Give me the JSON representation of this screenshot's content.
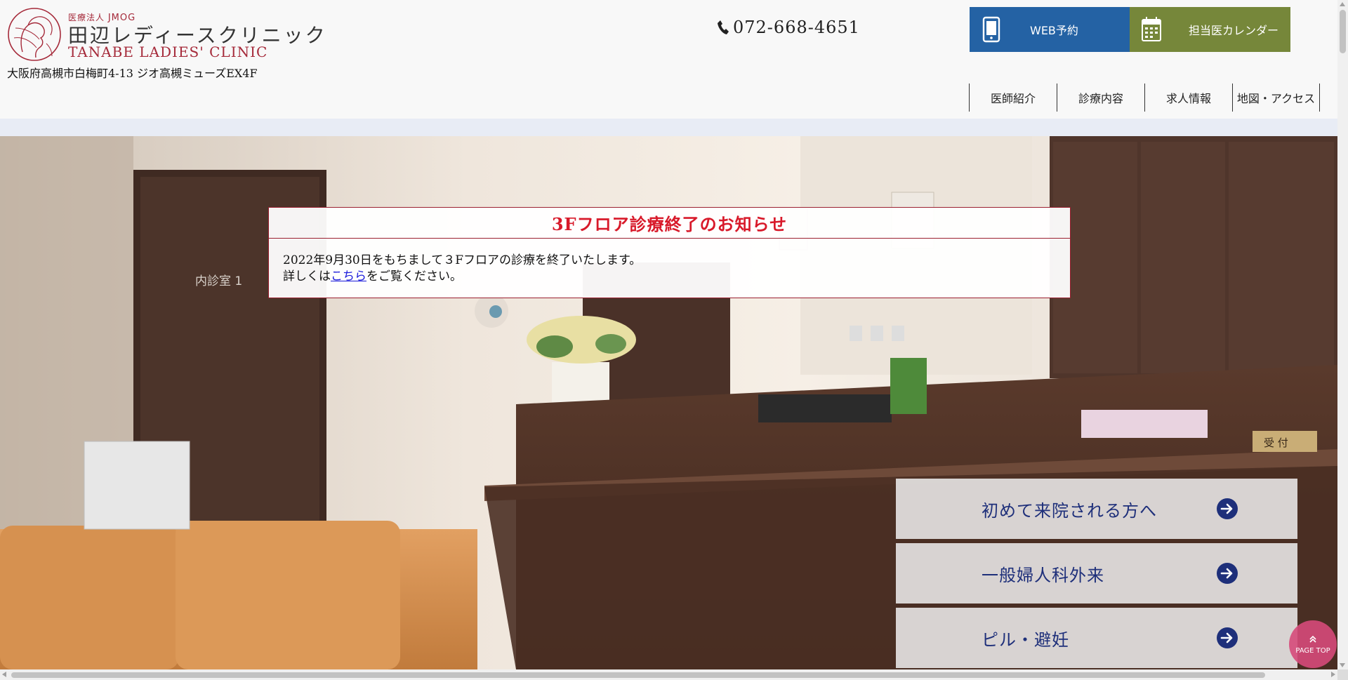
{
  "header": {
    "logo": {
      "corp_prefix": "医療法人",
      "corp_name": "JMOG",
      "name_ja": "田辺レディースクリニック",
      "name_en": "TANABE LADIES' CLINIC"
    },
    "address": "大阪府高槻市白梅町4-13 ジオ高槻ミューズEX4F",
    "phone": "072-668-4651",
    "web_button_label": "WEB予約",
    "calendar_button_label": "担当医カレンダー",
    "nav": [
      {
        "label": "医師紹介"
      },
      {
        "label": "診療内容"
      },
      {
        "label": "求人情報"
      },
      {
        "label": "地図・アクセス"
      }
    ]
  },
  "hero": {
    "room_sign": "内診室 1",
    "desk_sign": "受 付"
  },
  "notice": {
    "title": "3Fフロア診療終了のお知らせ",
    "line1": "2022年9月30日をもちまして３Fフロアの診療を終了いたします。",
    "line2_prefix": "詳しくは",
    "line2_link": "こちら",
    "line2_suffix": "をご覧ください。"
  },
  "menu_cards": [
    {
      "label": "初めて来院される方へ"
    },
    {
      "label": "一般婦人科外来"
    },
    {
      "label": "ピル・避妊"
    }
  ],
  "page_top": "PAGE TOP",
  "colors": {
    "brand": "#a52a3a",
    "web_button": "#2462a4",
    "calendar_button": "#76873a",
    "notice_title": "#d8192a",
    "card_text": "#1e2f7a",
    "page_top": "#d64a7a"
  }
}
